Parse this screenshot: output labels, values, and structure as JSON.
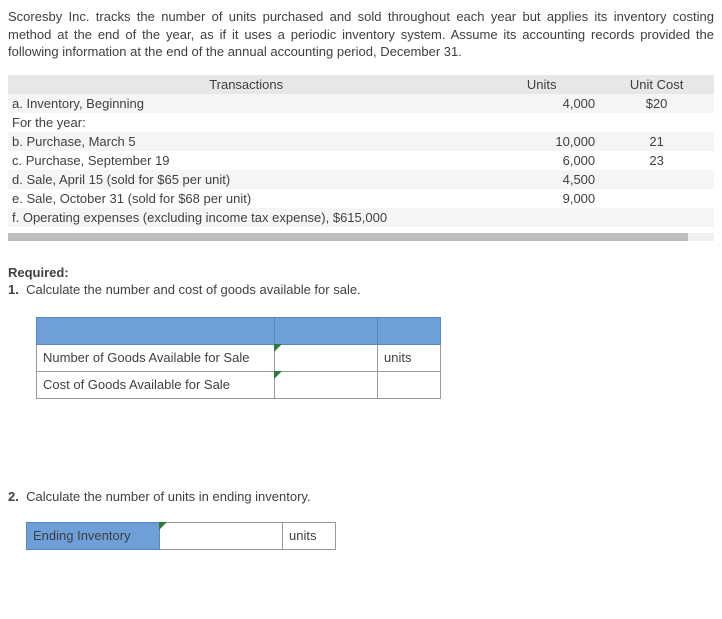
{
  "intro": "Scoresby Inc. tracks the number of units purchased and sold throughout each year but applies its inventory costing method at the end of the year, as if it uses a periodic inventory system. Assume its accounting records provided the following information at the end of the annual accounting period, December 31.",
  "headers": {
    "transactions": "Transactions",
    "units": "Units",
    "unit_cost": "Unit Cost"
  },
  "rows": [
    {
      "desc": "a. Inventory, Beginning",
      "units": "4,000",
      "cost": "$20"
    },
    {
      "desc": "For the year:",
      "units": "",
      "cost": ""
    },
    {
      "desc": "b. Purchase, March 5",
      "units": "10,000",
      "cost": "21"
    },
    {
      "desc": "c. Purchase, September 19",
      "units": "6,000",
      "cost": "23"
    },
    {
      "desc": "d. Sale, April 15 (sold for $65 per unit)",
      "units": "4,500",
      "cost": ""
    },
    {
      "desc": "e. Sale, October 31 (sold for $68 per unit)",
      "units": "9,000",
      "cost": ""
    },
    {
      "desc": "f. Operating expenses (excluding income tax expense), $615,000",
      "units": "",
      "cost": ""
    }
  ],
  "required_label": "Required:",
  "q1": {
    "num": "1.",
    "text": "Calculate the number and cost of goods available for sale.",
    "row1_label": "Number of Goods Available for Sale",
    "row1_unit": "units",
    "row2_label": "Cost of Goods Available for Sale"
  },
  "q2": {
    "num": "2.",
    "text": "Calculate the number of units in ending inventory.",
    "row_label": "Ending Inventory",
    "row_unit": "units"
  }
}
